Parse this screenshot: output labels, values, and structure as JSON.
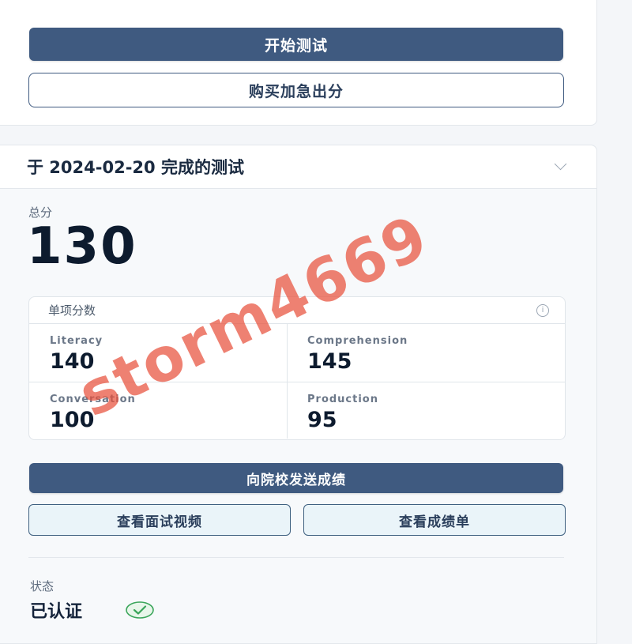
{
  "top_actions": {
    "start_test": "开始测试",
    "buy_express": "购买加急出分"
  },
  "result": {
    "header_title": "于 2024-02-20 完成的测试",
    "total_label": "总分",
    "total_value": "130",
    "subscores_title": "单项分数",
    "subscores": [
      {
        "name": "Literacy",
        "value": "140"
      },
      {
        "name": "Comprehension",
        "value": "145"
      },
      {
        "name": "Conversation",
        "value": "100"
      },
      {
        "name": "Production",
        "value": "95"
      }
    ],
    "send_button": "向院校发送成绩",
    "view_video_button": "查看面试视频",
    "view_report_button": "查看成绩单",
    "status_label": "状态",
    "status_value": "已认证",
    "status_color": "#3aa55a"
  },
  "watermark": "storm4669"
}
